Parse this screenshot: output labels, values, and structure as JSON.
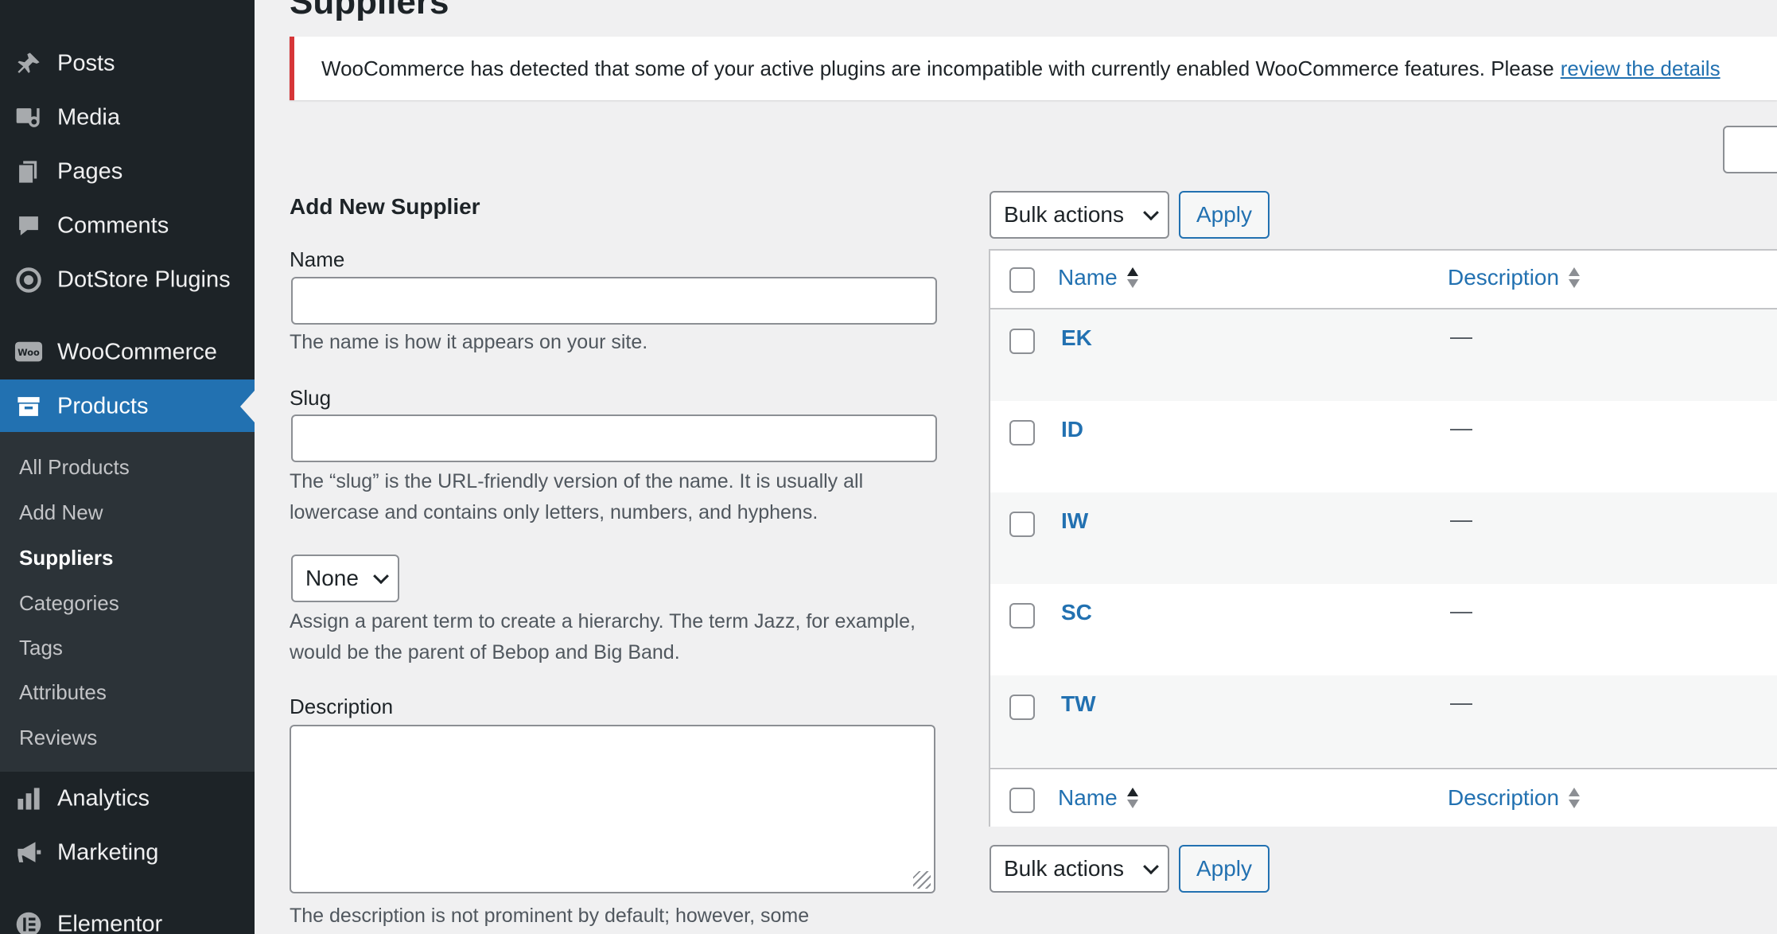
{
  "sidebar": {
    "items": [
      {
        "label": "Posts",
        "icon": "pin-icon"
      },
      {
        "label": "Media",
        "icon": "media-icon"
      },
      {
        "label": "Pages",
        "icon": "pages-icon"
      },
      {
        "label": "Comments",
        "icon": "comment-icon"
      },
      {
        "label": "DotStore Plugins",
        "icon": "target-icon"
      },
      {
        "label": "WooCommerce",
        "icon": "woo-icon"
      },
      {
        "label": "Products",
        "icon": "archive-icon"
      },
      {
        "label": "Analytics",
        "icon": "bar-chart-icon"
      },
      {
        "label": "Marketing",
        "icon": "megaphone-icon"
      },
      {
        "label": "Elementor",
        "icon": "elementor-icon"
      }
    ],
    "woo_badge": "Woo",
    "submenu": [
      "All Products",
      "Add New",
      "Suppliers",
      "Categories",
      "Tags",
      "Attributes",
      "Reviews"
    ]
  },
  "page": {
    "title": "Suppliers"
  },
  "notice": {
    "text": "WooCommerce has detected that some of your active plugins are incompatible with currently enabled WooCommerce features. Please",
    "link": "review the details"
  },
  "form": {
    "heading": "Add New Supplier",
    "name_label": "Name",
    "name_help": "The name is how it appears on your site.",
    "slug_label": "Slug",
    "slug_help": "The “slug” is the URL-friendly version of the name. It is usually all lowercase and contains only letters, numbers, and hyphens.",
    "parent_value": "None",
    "parent_help": "Assign a parent term to create a hierarchy. The term Jazz, for example, would be the parent of Bebop and Big Band.",
    "description_label": "Description",
    "description_help": "The description is not prominent by default; however, some"
  },
  "table": {
    "bulk_actions": "Bulk actions",
    "apply": "Apply",
    "col_name": "Name",
    "col_description": "Description",
    "rows": [
      {
        "name": "EK",
        "description": "—"
      },
      {
        "name": "ID",
        "description": "—"
      },
      {
        "name": "IW",
        "description": "—"
      },
      {
        "name": "SC",
        "description": "—"
      },
      {
        "name": "TW",
        "description": "—"
      }
    ]
  },
  "colors": {
    "sidebar": "#1d2327",
    "submenu": "#2c3338",
    "accent": "#2271b1",
    "notice_error": "#d63638"
  }
}
